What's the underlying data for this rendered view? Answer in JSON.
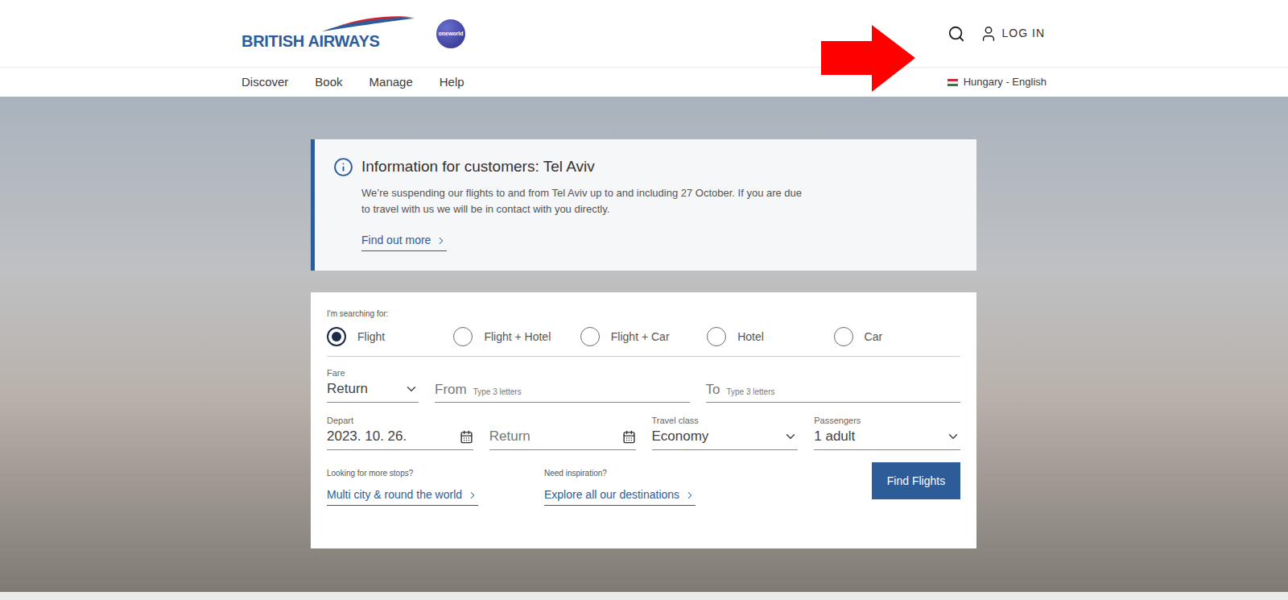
{
  "header": {
    "logo": "BRITISH AIRWAYS",
    "alliance_badge": "oneworld",
    "login": "LOG IN"
  },
  "nav": {
    "items": [
      "Discover",
      "Book",
      "Manage",
      "Help"
    ],
    "locale": "Hungary - English"
  },
  "notice": {
    "title": "Information for customers: Tel Aviv",
    "body": "We’re suspending our flights to and from Tel Aviv up to and including 27 October. If you are due to travel with us we will be in contact with you directly.",
    "link": "Find out more"
  },
  "search": {
    "searching_for_label": "I'm searching for:",
    "types": [
      {
        "label": "Flight",
        "selected": true
      },
      {
        "label": "Flight + Hotel",
        "selected": false
      },
      {
        "label": "Flight + Car",
        "selected": false
      },
      {
        "label": "Hotel",
        "selected": false
      },
      {
        "label": "Car",
        "selected": false
      }
    ],
    "fare": {
      "label": "Fare",
      "value": "Return"
    },
    "from": {
      "label": "From",
      "hint": "Type 3 letters"
    },
    "to": {
      "label": "To",
      "hint": "Type 3 letters"
    },
    "depart": {
      "label": "Depart",
      "value": "2023. 10. 26."
    },
    "return": {
      "placeholder": "Return"
    },
    "travel_class": {
      "label": "Travel class",
      "value": "Economy"
    },
    "passengers": {
      "label": "Passengers",
      "value": "1 adult"
    },
    "more_stops": {
      "label": "Looking for more stops?",
      "link": "Multi city & round the world"
    },
    "inspiration": {
      "label": "Need inspiration?",
      "link": "Explore all our destinations"
    },
    "submit": "Find Flights"
  }
}
